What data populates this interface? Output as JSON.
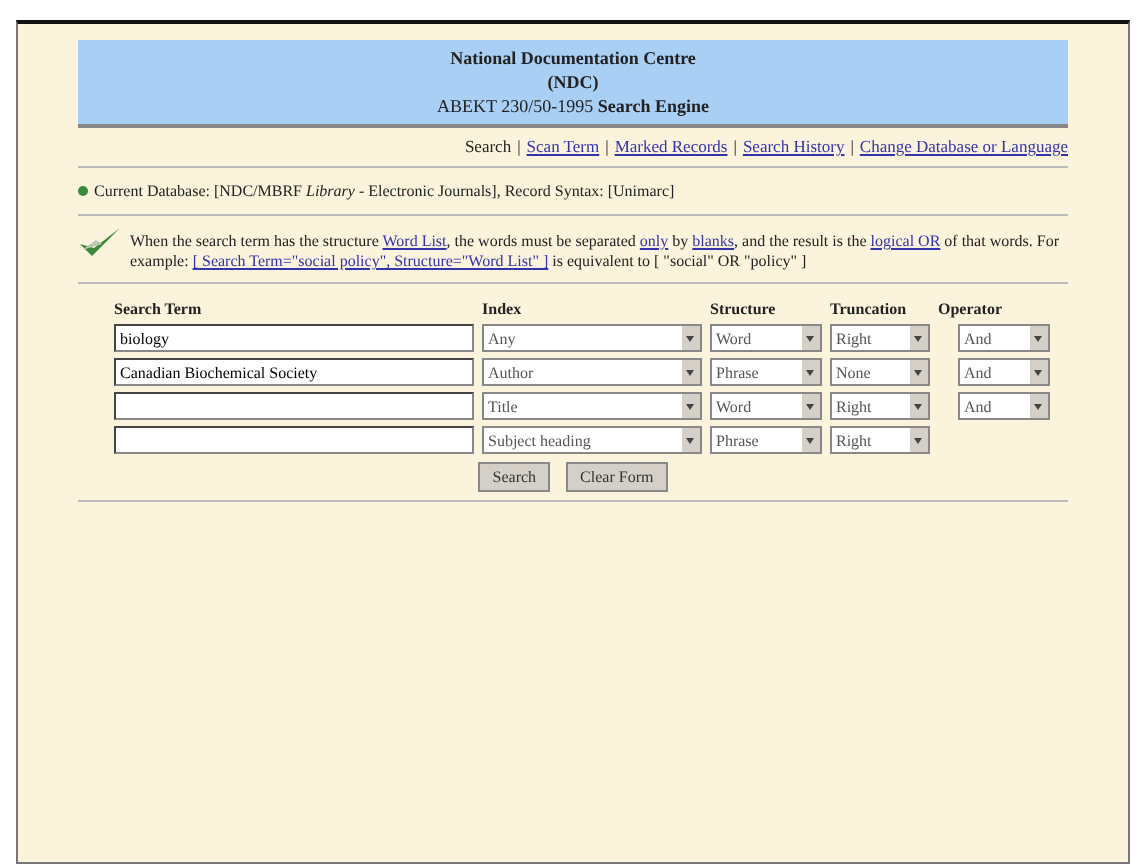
{
  "header": {
    "lines": [
      "National Documentation Centre",
      "(NDC)",
      "ABEKT 230/50-1995 **Search Engine**"
    ]
  },
  "nav": {
    "separator": "|",
    "items": [
      {
        "label": "Search",
        "selected": true
      },
      {
        "label": "Scan Term",
        "selected": false
      },
      {
        "label": "Marked Records",
        "selected": false
      },
      {
        "label": "Search History",
        "selected": false
      },
      {
        "label": "Change Database or Language",
        "selected": false
      }
    ]
  },
  "current_database": "Current Database: [NDC/MBRF *Library* - Electronic Journals], Record Syntax: [Unimarc]",
  "help_parts": [
    {
      "text": "When the search term has the structure ",
      "link": false
    },
    {
      "text": "Word List",
      "link": true
    },
    {
      "text": ", the words must be separated ",
      "link": false
    },
    {
      "text": "only",
      "link": true
    },
    {
      "text": " by ",
      "link": false
    },
    {
      "text": "blanks",
      "link": true
    },
    {
      "text": ", and the result is the ",
      "link": false
    },
    {
      "text": "logical OR",
      "link": true
    },
    {
      "text": " of that words. For example: ",
      "link": false
    },
    {
      "text": "[ Search Term=\"social policy\", Structure=\"Word List\" ]",
      "link": true
    },
    {
      "text": " is equivalent to [ \"social\" OR \"policy\" ]",
      "link": false
    }
  ],
  "form": {
    "columns": [
      "Search Term",
      "Index",
      "Structure",
      "Truncation",
      "Operator"
    ],
    "rows": [
      {
        "term": "biology",
        "index": "Any",
        "structure": "Word",
        "truncation": "Right",
        "operator": "And"
      },
      {
        "term": "Canadian Biochemical Society",
        "index": "Author",
        "structure": "Phrase",
        "truncation": "None",
        "operator": "And"
      },
      {
        "term": "",
        "index": "Title",
        "structure": "Word",
        "truncation": "Right",
        "operator": "And"
      },
      {
        "term": "",
        "index": "Subject heading",
        "structure": "Phrase",
        "truncation": "Right"
      }
    ]
  },
  "buttons": [
    "Search",
    "Clear Form"
  ]
}
